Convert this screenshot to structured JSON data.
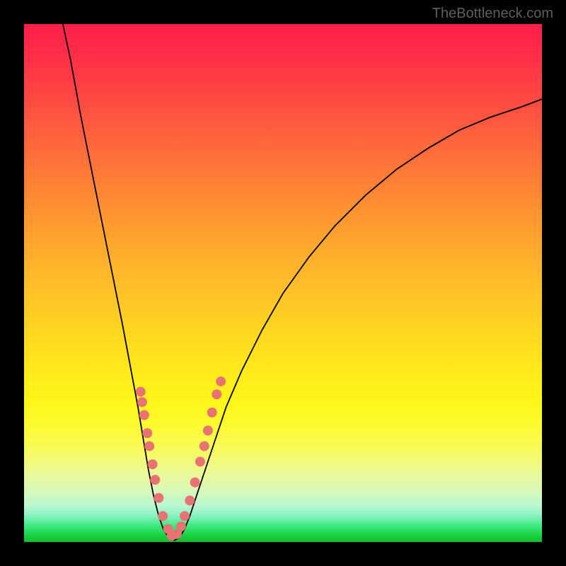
{
  "watermark_text": "TheBottleneck.com",
  "chart_data": {
    "type": "line",
    "title": "",
    "xlabel": "",
    "ylabel": "",
    "xlim": [
      0,
      100
    ],
    "ylim": [
      0,
      100
    ],
    "series": [
      {
        "name": "curve",
        "points": [
          [
            7.5,
            100
          ],
          [
            9,
            93
          ],
          [
            11,
            82
          ],
          [
            13,
            72
          ],
          [
            15,
            62
          ],
          [
            17,
            52
          ],
          [
            19,
            42
          ],
          [
            20.5,
            34
          ],
          [
            22,
            26
          ],
          [
            23,
            20
          ],
          [
            24,
            14
          ],
          [
            25,
            9
          ],
          [
            26,
            5
          ],
          [
            27,
            2.2
          ],
          [
            28,
            0.8
          ],
          [
            29,
            0.3
          ],
          [
            30,
            0.8
          ],
          [
            31,
            2.5
          ],
          [
            32,
            5
          ],
          [
            33.5,
            9.5
          ],
          [
            35,
            14
          ],
          [
            37,
            20
          ],
          [
            39,
            26
          ],
          [
            42,
            33
          ],
          [
            46,
            41
          ],
          [
            50,
            48
          ],
          [
            55,
            55
          ],
          [
            60,
            61
          ],
          [
            66,
            67
          ],
          [
            72,
            72
          ],
          [
            78,
            76
          ],
          [
            84,
            79.5
          ],
          [
            90,
            82
          ],
          [
            96,
            84
          ],
          [
            100,
            85.5
          ]
        ]
      }
    ],
    "markers": [
      [
        22.5,
        29
      ],
      [
        22.8,
        27
      ],
      [
        23.2,
        24.5
      ],
      [
        23.8,
        21
      ],
      [
        24.2,
        18.5
      ],
      [
        24.8,
        15
      ],
      [
        25.3,
        12
      ],
      [
        26,
        8.5
      ],
      [
        26.8,
        5
      ],
      [
        27.8,
        2.5
      ],
      [
        28.5,
        1.2
      ],
      [
        29.5,
        1.5
      ],
      [
        30.3,
        3
      ],
      [
        31,
        5
      ],
      [
        32,
        8
      ],
      [
        33,
        11.5
      ],
      [
        34,
        15.5
      ],
      [
        34.8,
        18.5
      ],
      [
        35.5,
        21.5
      ],
      [
        36.3,
        25
      ],
      [
        37.2,
        28.5
      ],
      [
        38,
        31
      ]
    ]
  }
}
